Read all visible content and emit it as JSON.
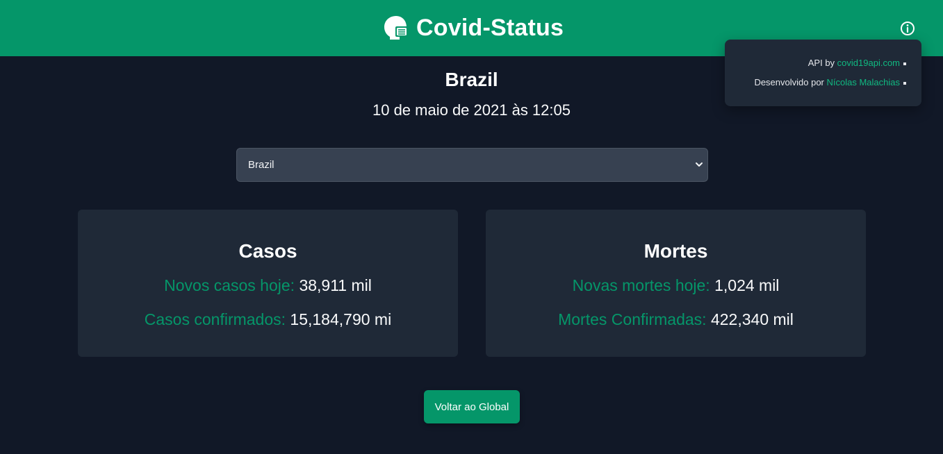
{
  "header": {
    "app_title": "Covid-Status",
    "logo_icon": "masked-face-icon",
    "info_icon": "info-circle-icon",
    "accent": "#059669"
  },
  "popover": {
    "api_prefix": "API by ",
    "api_link": "covid19api.com",
    "dev_prefix": "Desenvolvido por ",
    "dev_link": "Nícolas Malachias"
  },
  "main": {
    "country": "Brazil",
    "date": "10 de maio de 2021 às 12:05",
    "country_select": {
      "selected": "Brazil"
    }
  },
  "cards": {
    "cases": {
      "title": "Casos",
      "new_label": "Novos casos hoje:",
      "new_value": " 38,911 mil",
      "total_label": "Casos confirmados:",
      "total_value": " 15,184,790 mi"
    },
    "deaths": {
      "title": "Mortes",
      "new_label": "Novas mortes hoje:",
      "new_value": " 1,024 mil",
      "total_label": "Mortes Confirmadas:",
      "total_value": " 422,340 mil"
    }
  },
  "back_button": {
    "label": "Voltar ao Global"
  }
}
